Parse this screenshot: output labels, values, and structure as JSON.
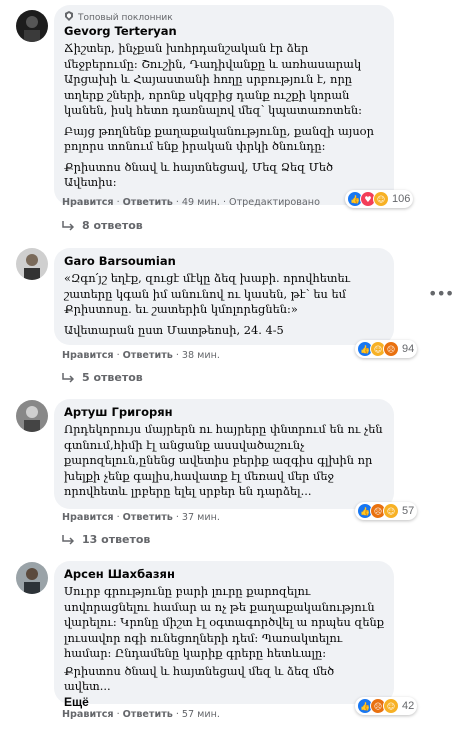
{
  "comments": [
    {
      "badge": "Топовый поклонник",
      "author": "Gevorg Terteryan",
      "paragraphs": [
        "Ճիշտեր, ինչքան խոհրդանշական էր ձեր մեջբերումը: Շուշին, Դադիվանքը և առհասարակ Արցախի և Հայաստանի հողը սրբություն է, որը տղերք շների, որոնք սկզբից դանք ուշքի կորան կանեն, իսկ հետո դառնալով մեզ՝ կպատառոտեն:",
        "Բայց թողնենք քաղաքականությունը, քանզի այսօր բոլորս տոնում ենք իրական փրկի ծնունդը:",
        "Քրիստոս ծնավ և հայտնեցավ, Մեզ Ձեզ Մեծ Ավետիս:"
      ],
      "more": "",
      "actions": {
        "like": "Нравится",
        "reply": "Ответить",
        "time": "49 мин.",
        "edited": "Отредактировано"
      },
      "reaction_count": "106",
      "replies": "8 ответов"
    },
    {
      "badge": "",
      "author": "Garo Barsoumian",
      "paragraphs": [
        "«Զգո՛յշ եղէք, զուցէ մէկը ձեզ խաբի. որովհետեւ շատերը կգան իմ անունով ու կասեն, թէ՝ ես եմ Քրիստոսը. եւ շատերին կմոլորեցնեն:»",
        "Ավետարան ըստ Մատթեոսի, 24. 4-5"
      ],
      "more": "",
      "actions": {
        "like": "Нравится",
        "reply": "Ответить",
        "time": "38 мин.",
        "edited": ""
      },
      "reaction_count": "94",
      "replies": "5 ответов"
    },
    {
      "badge": "",
      "author": "Артуш Григорян",
      "paragraphs": [
        "Որդեկորույս մայրերն ու հայրերը փնտրում են ու չեն գտնում,հիմի էլ անցանք ասսվածաշունչ քարոզելուն,ընենց ավետիս բերիք ազգիս գլխին որ խելքի չենք գալիս,հավատք էլ մեռավ մեր մեջ որովհետև լրբերը ելել սրբեր են դարձել..."
      ],
      "more": "",
      "actions": {
        "like": "Нравится",
        "reply": "Ответить",
        "time": "37 мин.",
        "edited": ""
      },
      "reaction_count": "57",
      "replies": "13 ответов"
    },
    {
      "badge": "",
      "author": "Арсен Шахбазян",
      "paragraphs": [
        "Սուրբ գրությունը բարի լուրը քարոզելու սովորացնելու համար ա ոչ թե քաղաքականություն վարելու: Կրոնը միշտ էլ օգտագործվել ա որպես զենք լուսավոր ոգի ունեցողների դեմ: Պառակտելու համար: Ընդամենը կարիք գրերը հետևալը:",
        "Քրիստոս ծնավ և հայտնեցավ մեզ և ձեզ մեծ ավետ..."
      ],
      "more": "Ещё",
      "actions": {
        "like": "Нравится",
        "reply": "Ответить",
        "time": "57 мин.",
        "edited": ""
      },
      "reaction_count": "42",
      "replies": ""
    }
  ],
  "colors": {
    "bubble": "#f0f2f5",
    "meta": "#65676b",
    "like": "#1877f2",
    "love": "#f33e58",
    "haha": "#f7b125",
    "angry": "#e9710f"
  },
  "icons": {
    "more_options": "more-horizontal-icon",
    "reply_arrow": "reply-arrow-icon",
    "badge": "fan-badge-icon"
  }
}
